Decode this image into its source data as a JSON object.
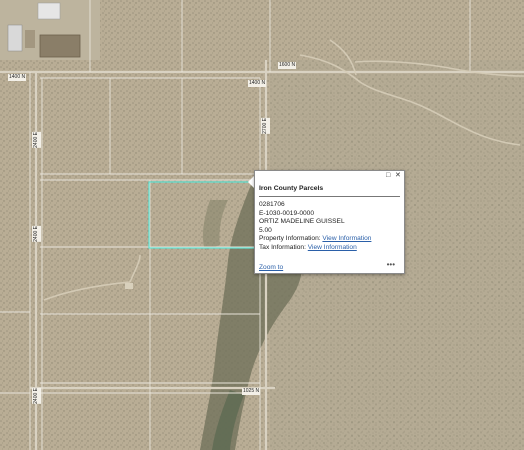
{
  "map": {
    "road_labels": {
      "top_left": "1400 N",
      "top_right": "1600 N",
      "mid_top": "1400 N",
      "bottom": "1025 N",
      "left_v1": "2400 E",
      "left_v2": "2400 E",
      "left_v3": "2400 E",
      "right_v": "2700 E"
    },
    "selected_parcel_color": "#5ee6d6"
  },
  "popup": {
    "title": "Iron County Parcels",
    "parcel_id": "0281706",
    "account": "E-1030-0019-0000",
    "owner": "ORTIZ MADELINE GUISSEL",
    "acres": "5.00",
    "property_label": "Property Information:",
    "property_link": "View Information",
    "tax_label": "Tax Information:",
    "tax_link": "View Information",
    "zoom_label": "Zoom to",
    "more_label": "•••",
    "maximize_icon": "maximize-icon",
    "close_icon": "close-icon"
  }
}
